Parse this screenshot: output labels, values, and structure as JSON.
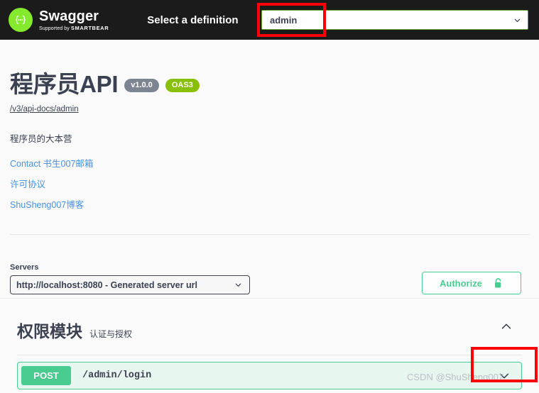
{
  "topbar": {
    "logo_title": "Swagger",
    "logo_supported_prefix": "Supported by",
    "logo_brand": "SMARTBEAR",
    "select_label": "Select a definition",
    "definition_value": "admin",
    "definition_chevron_icon": "chevron-down-icon"
  },
  "info": {
    "title": "程序员API",
    "version_badge": "v1.0.0",
    "spec_badge": "OAS3",
    "docs_url": "/v3/api-docs/admin",
    "description": "程序员的大本营",
    "links": [
      {
        "label": "Contact 书生007邮箱"
      },
      {
        "label": "许可协议"
      },
      {
        "label": "ShuSheng007博客"
      }
    ]
  },
  "servers": {
    "label": "Servers",
    "selected": "http://localhost:8080 - Generated server url",
    "chevron_icon": "chevron-down-icon"
  },
  "authorize": {
    "label": "Authorize",
    "icon": "unlocked-padlock-icon",
    "color": "#49cc90"
  },
  "tag_section": {
    "name": "权限模块",
    "description": "认证与授权",
    "toggle_icon": "chevron-up-icon",
    "operations": [
      {
        "method": "POST",
        "path": "/admin/login",
        "expand_icon": "chevron-down-icon",
        "method_color": "#49cc90"
      }
    ]
  },
  "watermark": {
    "text": "CSDN @ShuSheng007"
  },
  "annotations": {
    "definition_box_color": "#fb0007",
    "expand_box_color": "#fb0007"
  }
}
